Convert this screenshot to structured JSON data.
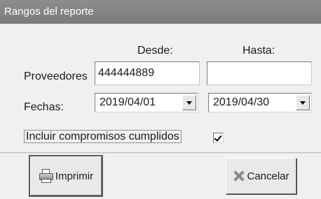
{
  "window": {
    "title": "Rangos del reporte"
  },
  "columns": {
    "from": "Desde:",
    "to": "Hasta:"
  },
  "proveedores": {
    "label": "Proveedores",
    "from_value": "444444889",
    "to_value": ""
  },
  "fechas": {
    "label": "Fechas:",
    "from_value": "2019/04/01",
    "to_value": "2019/04/30"
  },
  "options": {
    "include_completed_label": "Incluir compromisos cumplidos",
    "include_completed_checked": true
  },
  "buttons": {
    "print_label": "Imprimir",
    "cancel_label": "Cancelar"
  },
  "icons": {
    "print": "printer-icon",
    "cancel": "cancel-x-icon",
    "dropdown": "chevron-down-icon",
    "checkbox": "checkmark-icon"
  },
  "colors": {
    "title_bar": "#7b7b7b",
    "dialog_bg": "#f0f0f0"
  }
}
